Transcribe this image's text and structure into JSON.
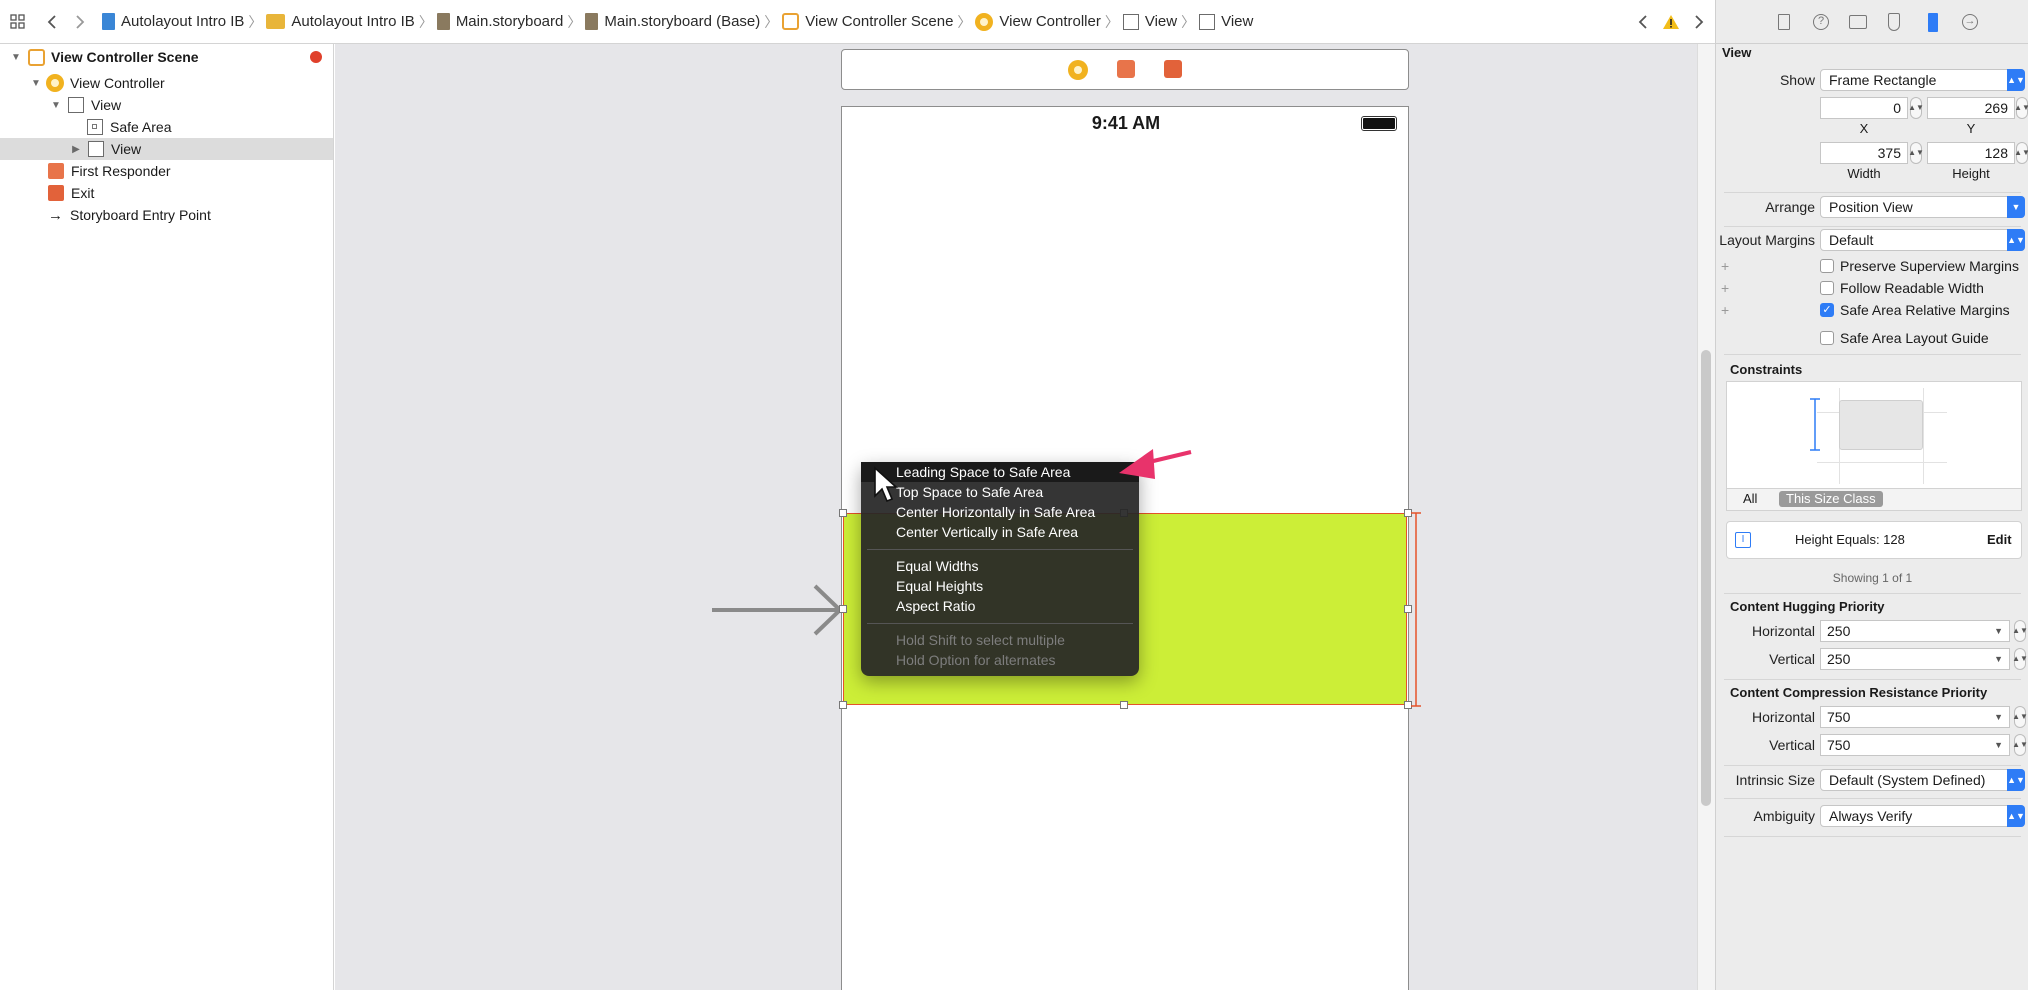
{
  "jumpbar": {
    "crumbs": [
      "Autolayout Intro IB",
      "Autolayout Intro IB",
      "Main.storyboard",
      "Main.storyboard (Base)",
      "View Controller Scene",
      "View Controller",
      "View",
      "View"
    ]
  },
  "outline": {
    "scene": "View Controller Scene",
    "view_controller": "View Controller",
    "view": "View",
    "safe_area": "Safe Area",
    "subview": "View",
    "first_responder": "First Responder",
    "exit": "Exit",
    "entry_point": "Storyboard Entry Point"
  },
  "device": {
    "time": "9:41 AM"
  },
  "menu": {
    "items": [
      "Leading Space to Safe Area",
      "Top Space to Safe Area",
      "Center Horizontally in Safe Area",
      "Center Vertically in Safe Area",
      "Equal Widths",
      "Equal Heights",
      "Aspect Ratio",
      "Hold Shift to select multiple",
      "Hold Option for alternates"
    ]
  },
  "inspector": {
    "title": "View",
    "show_label": "Show",
    "show_value": "Frame Rectangle",
    "x": "0",
    "y": "269",
    "x_label": "X",
    "y_label": "Y",
    "width": "375",
    "height": "128",
    "width_label": "Width",
    "height_label": "Height",
    "arrange_label": "Arrange",
    "arrange_value": "Position View",
    "margins_label": "Layout Margins",
    "margins_value": "Default",
    "cb_preserve": "Preserve Superview Margins",
    "cb_readable": "Follow Readable Width",
    "cb_safe_margins": "Safe Area Relative Margins",
    "cb_safe_guide": "Safe Area Layout Guide",
    "constraints_title": "Constraints",
    "seg_all": "All",
    "seg_size_class": "This Size Class",
    "constraint_text": "Height Equals:  128",
    "edit": "Edit",
    "showing": "Showing 1 of 1",
    "hugging_title": "Content Hugging Priority",
    "horizontal_label": "Horizontal",
    "vertical_label": "Vertical",
    "hug_h": "250",
    "hug_v": "250",
    "compression_title": "Content Compression Resistance Priority",
    "comp_h": "750",
    "comp_v": "750",
    "intrinsic_label": "Intrinsic Size",
    "intrinsic_value": "Default (System Defined)",
    "ambiguity_label": "Ambiguity",
    "ambiguity_value": "Always Verify"
  },
  "colors": {
    "selected_view": "#ccee37",
    "selection_border": "#e5532a",
    "accent": "#2e7cf6",
    "annotation_arrow": "#e8336b"
  }
}
